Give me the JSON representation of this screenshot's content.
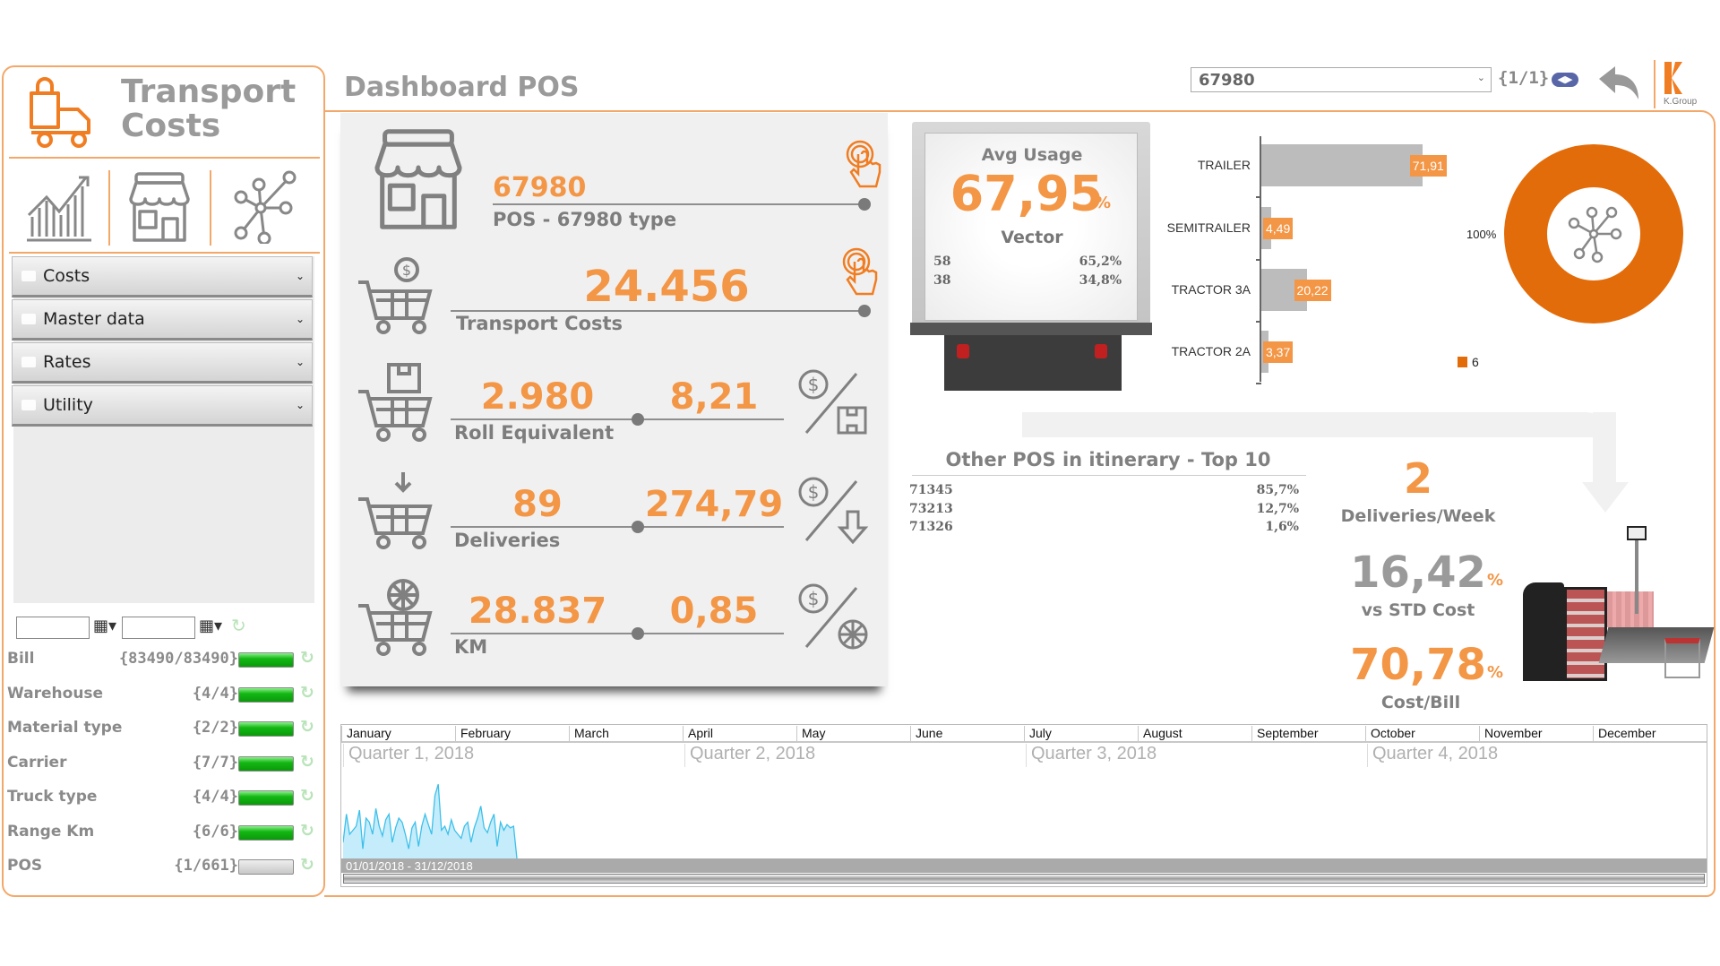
{
  "app": {
    "title_line1": "Transport",
    "title_line2": "Costs",
    "page_title": "Dashboard POS"
  },
  "accent": "#f39646",
  "nav_icons": [
    "chart-growth-icon",
    "store-icon",
    "network-icon"
  ],
  "menu": [
    {
      "label": "Costs"
    },
    {
      "label": "Master data"
    },
    {
      "label": "Rates"
    },
    {
      "label": "Utility"
    }
  ],
  "date_filter": {
    "from": "",
    "to": ""
  },
  "filters": [
    {
      "label": "Bill",
      "count": "{83490/83490}",
      "selected_fraction": 1
    },
    {
      "label": "Warehouse",
      "count": "{4/4}",
      "selected_fraction": 1
    },
    {
      "label": "Material type",
      "count": "{2/2}",
      "selected_fraction": 1
    },
    {
      "label": "Carrier",
      "count": "{7/7}",
      "selected_fraction": 1
    },
    {
      "label": "Truck type",
      "count": "{4/4}",
      "selected_fraction": 1
    },
    {
      "label": "Range Km",
      "count": "{6/6}",
      "selected_fraction": 1
    },
    {
      "label": "POS",
      "count": "{1/661}",
      "selected_fraction": 0
    }
  ],
  "search": {
    "value": "67980",
    "pager": "{1/1}"
  },
  "logo": {
    "text": "K.Group"
  },
  "kpis": {
    "pos_id": "67980",
    "pos_label": "POS - 67980 type",
    "transport_costs": "24.456",
    "transport_costs_label": "Transport Costs",
    "roll_equivalent": "2.980",
    "roll_equivalent_label": "Roll Equivalent",
    "cost_per_roll": "8,21",
    "deliveries": "89",
    "deliveries_label": "Deliveries",
    "cost_per_delivery": "274,79",
    "km": "28.837",
    "km_label": "KM",
    "cost_per_km": "0,85"
  },
  "truck": {
    "title": "Avg Usage",
    "value": "67,95",
    "unit": "%",
    "vehicle": "Vector",
    "rows": [
      {
        "count": "58",
        "pct": "65,2%"
      },
      {
        "count": "38",
        "pct": "34,8%"
      }
    ]
  },
  "truck_chart": {
    "type": "bar",
    "categories": [
      "TRAILER",
      "SEMITRAILER",
      "TRACTOR 3A",
      "TRACTOR 2A"
    ],
    "values": [
      71.91,
      4.49,
      20.22,
      3.37
    ],
    "labels": [
      "71,91",
      "4,49",
      "20,22",
      "3,37"
    ]
  },
  "donut": {
    "type": "pie",
    "label": "100%",
    "legend": "6",
    "value": 100,
    "color": "#e36c0a"
  },
  "other_pos": {
    "title": "Other POS in itinerary - Top 10",
    "rows": [
      {
        "id": "71345",
        "pct": "85,7%"
      },
      {
        "id": "73213",
        "pct": "12,7%"
      },
      {
        "id": "71326",
        "pct": "1,6%"
      }
    ]
  },
  "right_kpis": {
    "deliveries_week": "2",
    "deliveries_week_label": "Deliveries/Week",
    "vs_std": "16,42",
    "vs_std_label": "vs STD Cost",
    "cost_bill": "70,78",
    "cost_bill_label": "Cost/Bill",
    "unit": "%"
  },
  "timeline": {
    "months": [
      "January",
      "February",
      "March",
      "April",
      "May",
      "June",
      "July",
      "August",
      "September",
      "October",
      "November",
      "December"
    ],
    "quarters": [
      "Quarter 1, 2018",
      "Quarter 2, 2018",
      "Quarter 3, 2018",
      "Quarter 4, 2018"
    ],
    "range": "01/01/2018 - 31/12/2018",
    "series": [
      20,
      55,
      30,
      35,
      40,
      60,
      12,
      50,
      45,
      30,
      62,
      40,
      28,
      48,
      55,
      20,
      38,
      50,
      45,
      30,
      12,
      38,
      45,
      15,
      40,
      55,
      42,
      30,
      78,
      92,
      35,
      40,
      30,
      48,
      35,
      30,
      25,
      40,
      45,
      20,
      38,
      50,
      65,
      38,
      32,
      45,
      55,
      15,
      45,
      35,
      42,
      38,
      40,
      0
    ]
  }
}
